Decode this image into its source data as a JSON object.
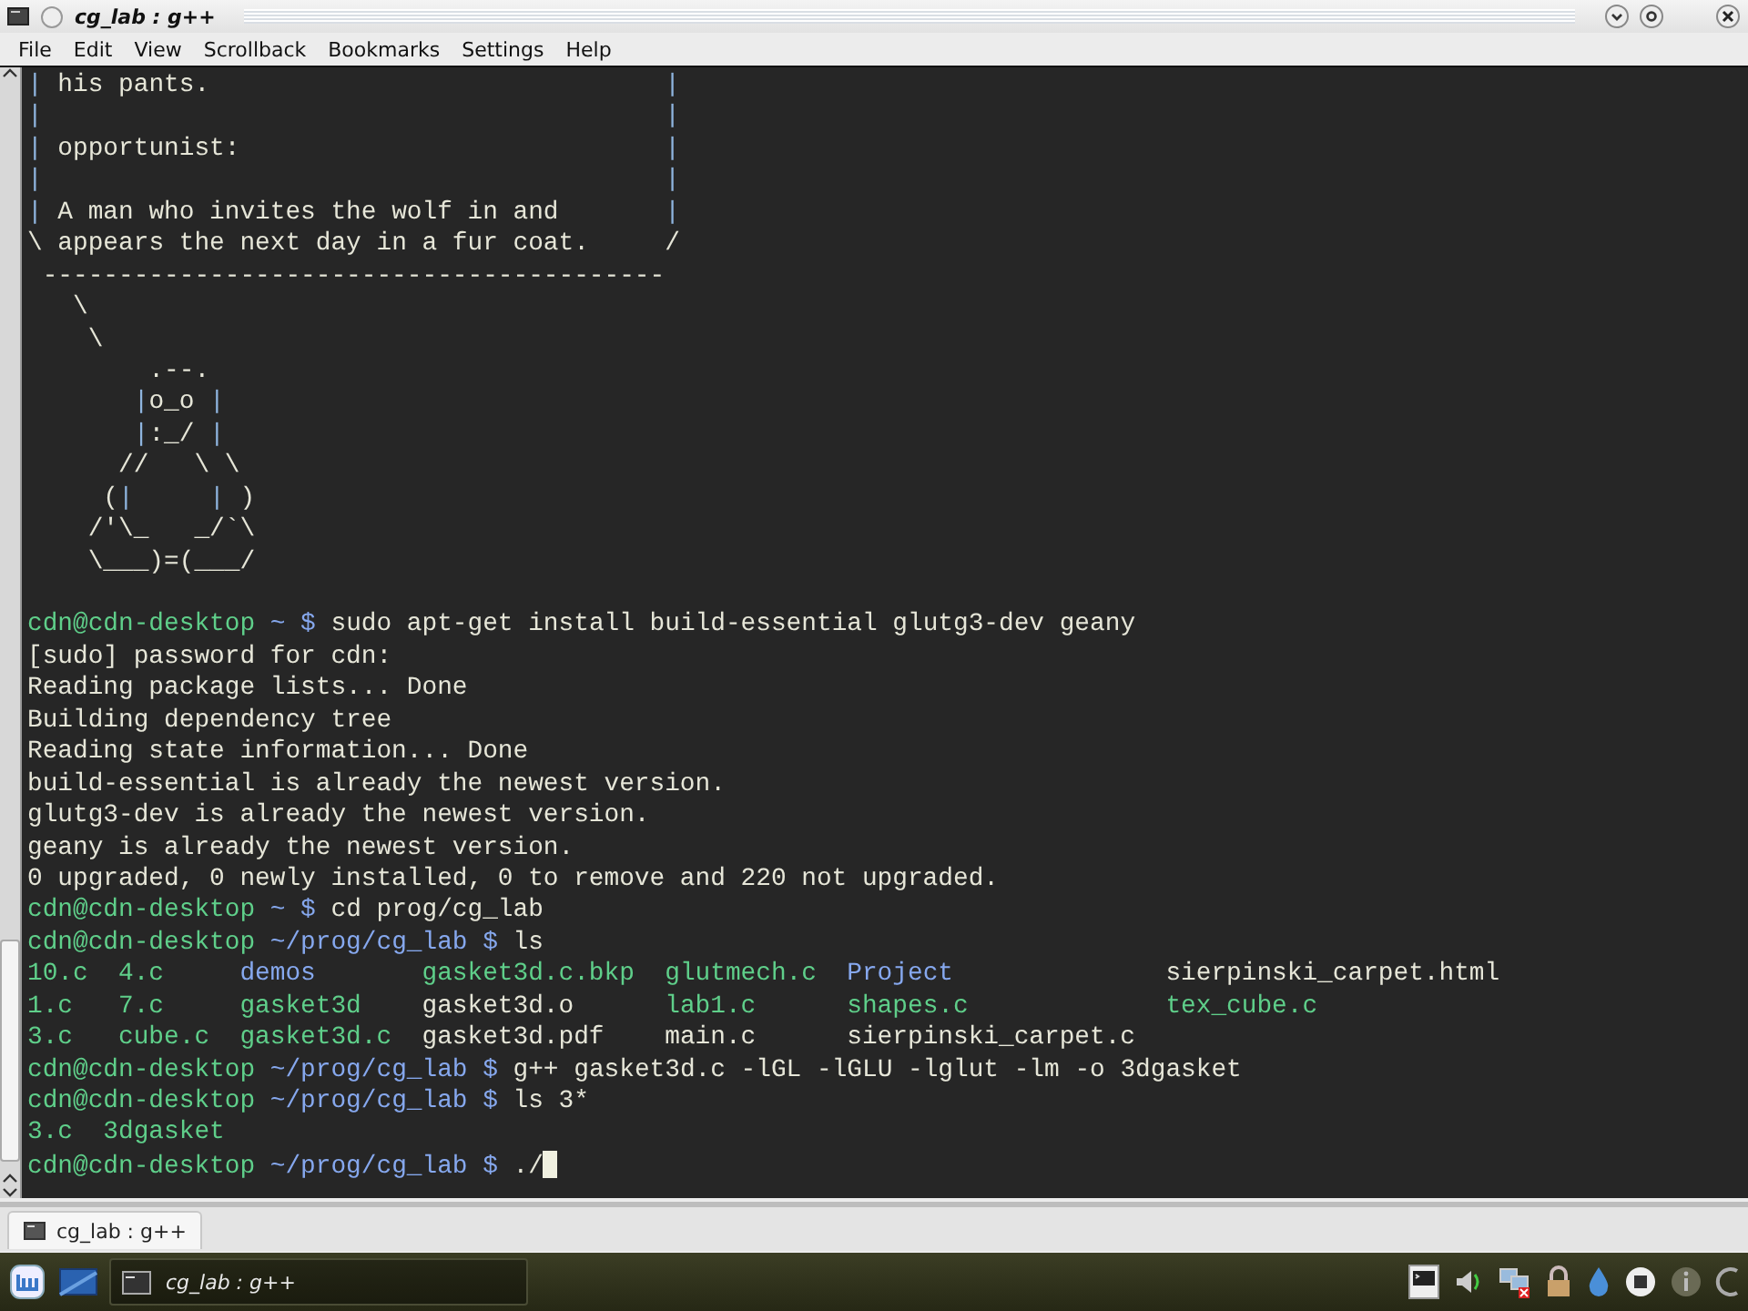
{
  "window": {
    "title": "cg_lab : g++"
  },
  "menu": [
    "File",
    "Edit",
    "View",
    "Scrollback",
    "Bookmarks",
    "Settings",
    "Help"
  ],
  "terminal": {
    "lines": [
      {
        "kind": "box",
        "segments": [
          {
            "kind": "border",
            "text": "|"
          },
          {
            "kind": "text",
            "text": " his pants."
          },
          {
            "kind": "border",
            "text": "|"
          }
        ]
      },
      {
        "kind": "box",
        "segments": [
          {
            "kind": "border",
            "text": "|"
          },
          {
            "kind": "border",
            "text": "|"
          }
        ]
      },
      {
        "kind": "box",
        "segments": [
          {
            "kind": "border",
            "text": "|"
          },
          {
            "kind": "text",
            "text": " opportunist:"
          },
          {
            "kind": "border",
            "text": "|"
          }
        ]
      },
      {
        "kind": "box",
        "segments": [
          {
            "kind": "border",
            "text": "|"
          },
          {
            "kind": "border",
            "text": "|"
          }
        ]
      },
      {
        "kind": "box",
        "segments": [
          {
            "kind": "border",
            "text": "|"
          },
          {
            "kind": "text",
            "text": " A man who invites the wolf in and"
          },
          {
            "kind": "border",
            "text": "|"
          }
        ]
      },
      {
        "kind": "box",
        "segments": [
          {
            "kind": "text",
            "text": "\\"
          },
          {
            "kind": "text",
            "text": " appears the next day in a fur coat."
          },
          {
            "kind": "text",
            "text": "/"
          }
        ]
      },
      {
        "segments": [
          {
            "kind": "text",
            "text": " -----------------------------------------"
          }
        ]
      },
      {
        "segments": [
          {
            "kind": "text",
            "text": "   \\"
          }
        ]
      },
      {
        "segments": [
          {
            "kind": "text",
            "text": "    \\"
          }
        ]
      },
      {
        "segments": [
          {
            "kind": "text",
            "text": "        .--."
          }
        ]
      },
      {
        "segments": [
          {
            "kind": "border",
            "text": "       |"
          },
          {
            "kind": "text",
            "text": "o_o "
          },
          {
            "kind": "border",
            "text": "|"
          }
        ]
      },
      {
        "segments": [
          {
            "kind": "border",
            "text": "       |"
          },
          {
            "kind": "text",
            "text": ":_/ "
          },
          {
            "kind": "border",
            "text": "|"
          }
        ]
      },
      {
        "segments": [
          {
            "kind": "text",
            "text": "      //   \\ \\"
          }
        ]
      },
      {
        "segments": [
          {
            "kind": "text",
            "text": "     ("
          },
          {
            "kind": "border",
            "text": "|     |"
          },
          {
            "kind": "text",
            "text": " )"
          }
        ]
      },
      {
        "segments": [
          {
            "kind": "text",
            "text": "    /'\\_   _/`\\"
          }
        ]
      },
      {
        "segments": [
          {
            "kind": "text",
            "text": "    \\___)=(___/"
          }
        ]
      },
      {
        "kind": "blank"
      },
      {
        "segments": [
          {
            "kind": "prompt",
            "text": "cdn@cdn-desktop"
          },
          {
            "kind": "path",
            "text": " ~ $ "
          },
          {
            "kind": "text",
            "text": "sudo apt-get install build-essential glutg3-dev geany"
          }
        ]
      },
      {
        "segments": [
          {
            "kind": "text",
            "text": "[sudo] password for cdn:"
          }
        ]
      },
      {
        "segments": [
          {
            "kind": "text",
            "text": "Reading package lists... Done"
          }
        ]
      },
      {
        "segments": [
          {
            "kind": "text",
            "text": "Building dependency tree"
          }
        ]
      },
      {
        "segments": [
          {
            "kind": "text",
            "text": "Reading state information... Done"
          }
        ]
      },
      {
        "segments": [
          {
            "kind": "text",
            "text": "build-essential is already the newest version."
          }
        ]
      },
      {
        "segments": [
          {
            "kind": "text",
            "text": "glutg3-dev is already the newest version."
          }
        ]
      },
      {
        "segments": [
          {
            "kind": "text",
            "text": "geany is already the newest version."
          }
        ]
      },
      {
        "segments": [
          {
            "kind": "text",
            "text": "0 upgraded, 0 newly installed, 0 to remove and 220 not upgraded."
          }
        ]
      },
      {
        "segments": [
          {
            "kind": "prompt",
            "text": "cdn@cdn-desktop"
          },
          {
            "kind": "path",
            "text": " ~ $ "
          },
          {
            "kind": "text",
            "text": "cd prog/cg_lab"
          }
        ]
      },
      {
        "segments": [
          {
            "kind": "prompt",
            "text": "cdn@cdn-desktop"
          },
          {
            "kind": "path",
            "text": " ~/prog/cg_lab $ "
          },
          {
            "kind": "text",
            "text": "ls"
          }
        ]
      },
      {
        "segments": [
          {
            "kind": "exec",
            "text": "10.c  4.c     "
          },
          {
            "kind": "dir",
            "text": "demos       "
          },
          {
            "kind": "exec",
            "text": "gasket3d.c.bkp  glutmech.c  "
          },
          {
            "kind": "dir",
            "text": "Project              "
          },
          {
            "kind": "text",
            "text": "sierpinski_carpet.html"
          }
        ]
      },
      {
        "segments": [
          {
            "kind": "exec",
            "text": "1.c   7.c     gasket3d    "
          },
          {
            "kind": "text",
            "text": "gasket3d.o      "
          },
          {
            "kind": "exec",
            "text": "lab1.c      shapes.c             tex_cube.c"
          }
        ]
      },
      {
        "segments": [
          {
            "kind": "exec",
            "text": "3.c   cube.c  gasket3d.c  "
          },
          {
            "kind": "text",
            "text": "gasket3d.pdf    main.c      sierpinski_carpet.c"
          }
        ]
      },
      {
        "segments": [
          {
            "kind": "prompt",
            "text": "cdn@cdn-desktop"
          },
          {
            "kind": "path",
            "text": " ~/prog/cg_lab $ "
          },
          {
            "kind": "text",
            "text": "g++ gasket3d.c -lGL -lGLU -lglut -lm -o 3dgasket"
          }
        ]
      },
      {
        "segments": [
          {
            "kind": "prompt",
            "text": "cdn@cdn-desktop"
          },
          {
            "kind": "path",
            "text": " ~/prog/cg_lab $ "
          },
          {
            "kind": "text",
            "text": "ls 3*"
          }
        ]
      },
      {
        "segments": [
          {
            "kind": "exec",
            "text": "3.c  3dgasket"
          }
        ]
      },
      {
        "segments": [
          {
            "kind": "prompt",
            "text": "cdn@cdn-desktop"
          },
          {
            "kind": "path",
            "text": " ~/prog/cg_lab $ "
          },
          {
            "kind": "text",
            "text": "./"
          }
        ],
        "cursor": true
      }
    ]
  },
  "session_tabs": [
    {
      "label": "cg_lab : g++",
      "selected": true
    }
  ],
  "taskbar": {
    "tasks": [
      {
        "label": "cg_lab : g++",
        "selected": true
      }
    ]
  }
}
